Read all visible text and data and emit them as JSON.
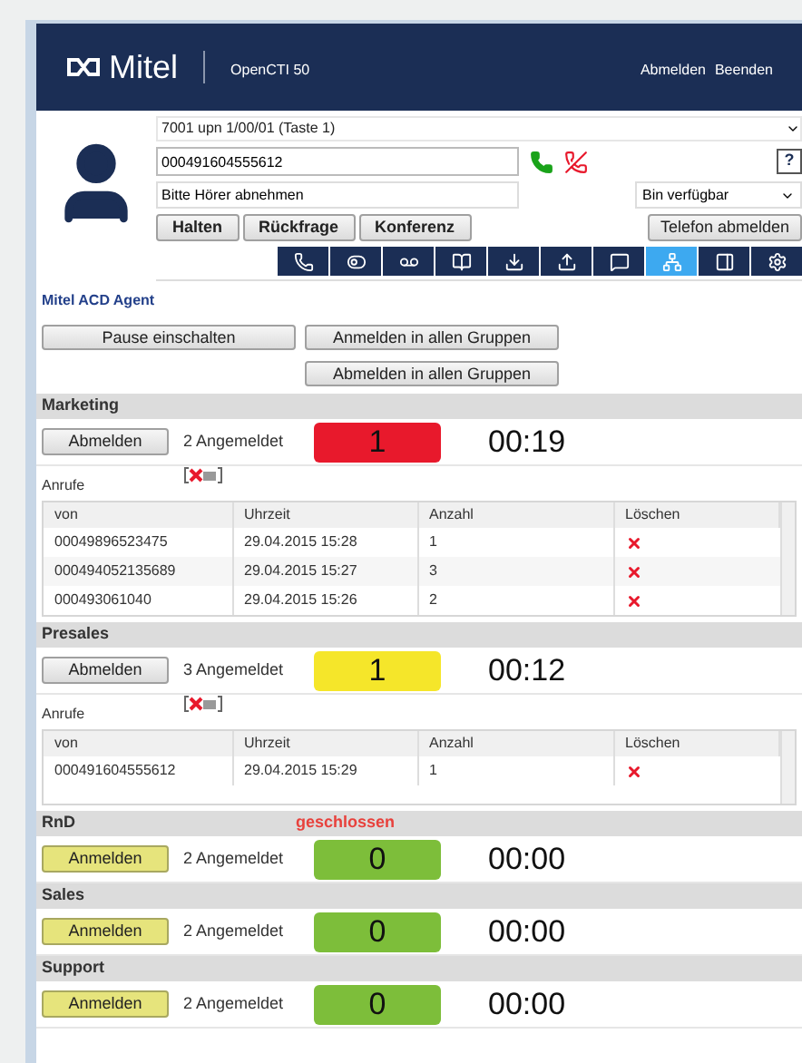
{
  "header": {
    "logo": "Mitel",
    "product": "OpenCTI 50",
    "links": [
      "Abmelden",
      "Beenden"
    ]
  },
  "phone": {
    "line": "7001 upn 1/00/01 (Taste 1)",
    "number": "000491604555612",
    "help": "?",
    "message": "Bitte Hörer abnehmen",
    "presence": "Bin verfügbar",
    "buttons": [
      "Halten",
      "Rückfrage",
      "Konferenz"
    ],
    "logout": "Telefon abmelden"
  },
  "toolbar": [
    {
      "kind": "calls",
      "selected": false
    },
    {
      "kind": "toggle",
      "selected": false
    },
    {
      "kind": "voicemail",
      "selected": false
    },
    {
      "kind": "book",
      "selected": false
    },
    {
      "kind": "download",
      "selected": false
    },
    {
      "kind": "upload",
      "selected": false
    },
    {
      "kind": "message",
      "selected": false
    },
    {
      "kind": "tree",
      "selected": true
    },
    {
      "kind": "panel",
      "selected": false
    },
    {
      "kind": "settings",
      "selected": false
    }
  ],
  "agent": {
    "title": "Mitel ACD Agent",
    "pause": "Pause einschalten",
    "login_all": "Anmelden in allen Gruppen",
    "logout_all": "Abmelden in allen Gruppen"
  },
  "groups": [
    {
      "name": "Marketing",
      "button": "Abmelden",
      "kind": "logged_in",
      "count": "2 Angemeldet",
      "queue": "1",
      "color": "#e8192c",
      "time": "00:19",
      "calls_label": "Anrufe",
      "columns": [
        "von",
        "Uhrzeit",
        "Anzahl",
        "Löschen"
      ],
      "rows": [
        [
          "00049896523475",
          "29.04.2015 15:28",
          "1"
        ],
        [
          "000494052135689",
          "29.04.2015 15:27",
          "3"
        ],
        [
          "000493061040",
          "29.04.2015 15:26",
          "2"
        ]
      ]
    },
    {
      "name": "Presales",
      "button": "Abmelden",
      "kind": "logged_in",
      "count": "3 Angemeldet",
      "queue": "1",
      "color": "#f5e62a",
      "time": "00:12",
      "calls_label": "Anrufe",
      "columns": [
        "von",
        "Uhrzeit",
        "Anzahl",
        "Löschen"
      ],
      "rows": [
        [
          "000491604555612",
          "29.04.2015 15:29",
          "1"
        ]
      ]
    },
    {
      "name": "RnD",
      "status": "geschlossen",
      "button": "Anmelden",
      "kind": "logged_out",
      "count": "2 Angemeldet",
      "queue": "0",
      "color": "#7dbe3a",
      "time": "00:00"
    },
    {
      "name": "Sales",
      "button": "Anmelden",
      "kind": "logged_out",
      "count": "2 Angemeldet",
      "queue": "0",
      "color": "#7dbe3a",
      "time": "00:00"
    },
    {
      "name": "Support",
      "button": "Anmelden",
      "kind": "logged_out",
      "count": "2 Angemeldet",
      "queue": "0",
      "color": "#7dbe3a",
      "time": "00:00"
    }
  ]
}
